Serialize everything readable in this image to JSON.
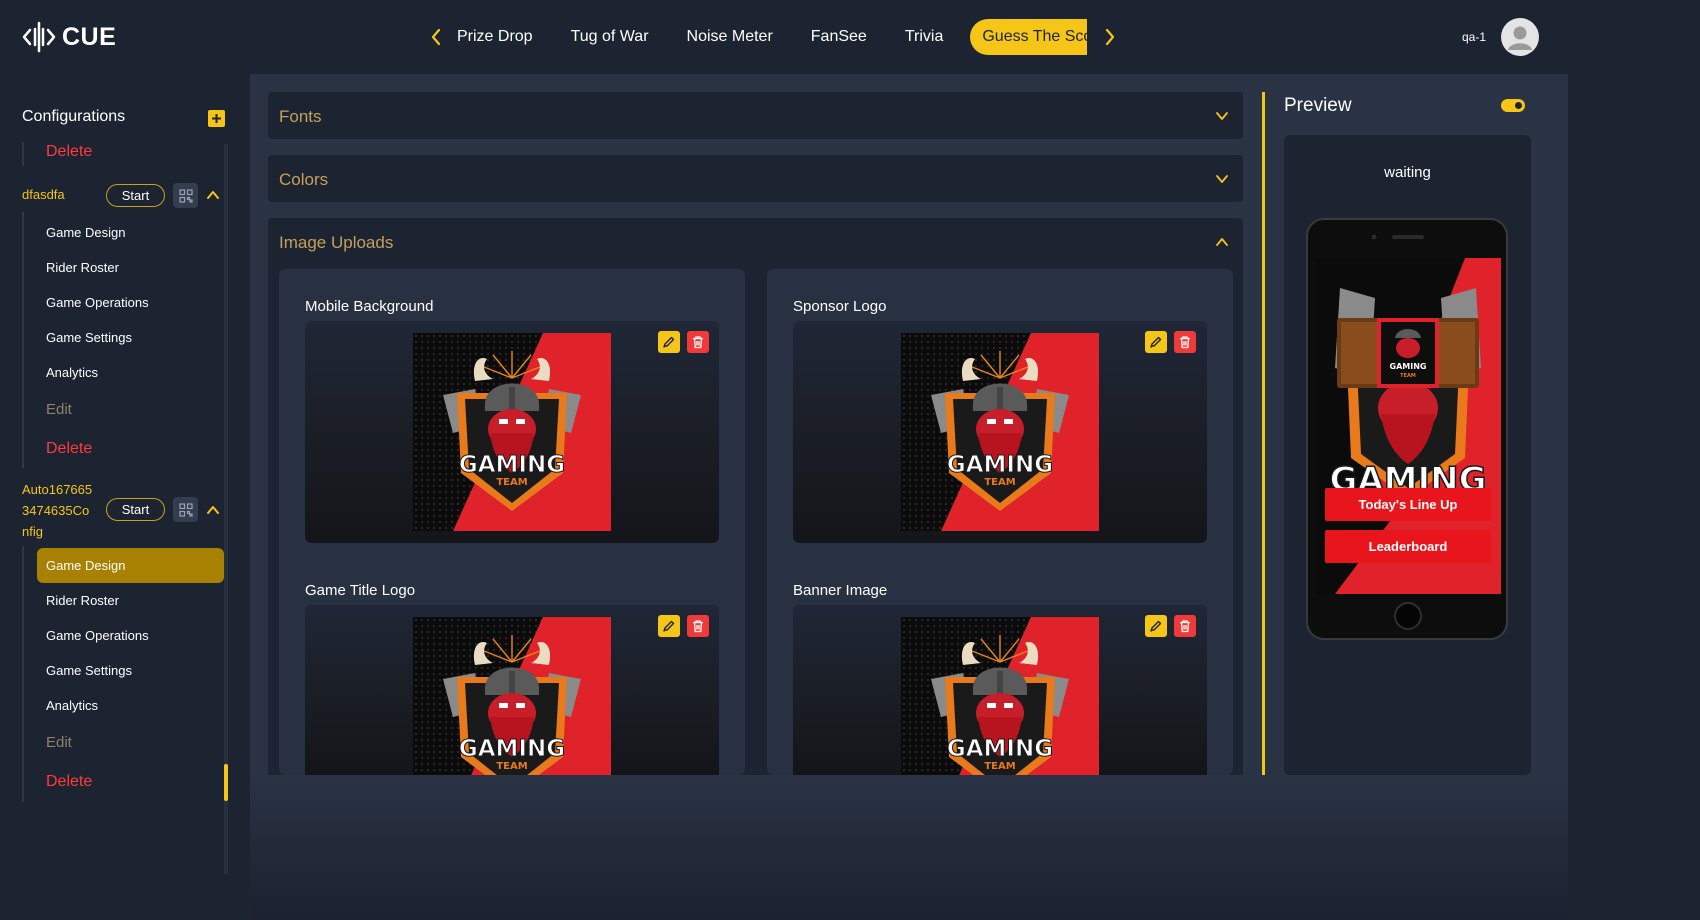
{
  "app": {
    "logo_text": "CUE",
    "logo_icon": "soundwave-icon"
  },
  "nav": {
    "tabs": [
      {
        "label": "Prize Drop",
        "active": false
      },
      {
        "label": "Tug of War",
        "active": false
      },
      {
        "label": "Noise Meter",
        "active": false
      },
      {
        "label": "FanSee",
        "active": false
      },
      {
        "label": "Trivia",
        "active": false
      },
      {
        "label": "Guess The Score",
        "active": true
      }
    ],
    "prev_icon": "chevron-left-icon",
    "next_icon": "chevron-right-icon"
  },
  "user": {
    "name": "qa-1",
    "avatar_icon": "user-avatar-icon"
  },
  "sidebar": {
    "title": "Configurations",
    "add_icon": "plus-icon",
    "top_delete": "Delete",
    "groups": [
      {
        "name": "dfasdfa",
        "start_label": "Start",
        "qr_icon": "qr-code-icon",
        "items": [
          "Game Design",
          "Rider Roster",
          "Game Operations",
          "Game Settings",
          "Analytics"
        ],
        "edit_label": "Edit",
        "delete_label": "Delete"
      },
      {
        "name_lines": [
          "Auto167665",
          "3474635Co",
          "nfig"
        ],
        "start_label": "Start",
        "qr_icon": "qr-code-icon",
        "items": [
          "Game Design",
          "Rider Roster",
          "Game Operations",
          "Game Settings",
          "Analytics"
        ],
        "active_item": "Game Design",
        "edit_label": "Edit",
        "delete_label": "Delete"
      }
    ]
  },
  "sections": {
    "fonts": {
      "title": "Fonts",
      "expanded": false
    },
    "colors": {
      "title": "Colors",
      "expanded": false
    },
    "image_uploads": {
      "title": "Image Uploads",
      "expanded": true,
      "cards": [
        {
          "label": "Mobile Background",
          "logo_main": "GAMING",
          "logo_sub": "TEAM"
        },
        {
          "label": "Sponsor Logo",
          "logo_main": "GAMING",
          "logo_sub": "TEAM"
        },
        {
          "label": "Game Title Logo",
          "logo_main": "GAMING",
          "logo_sub": "TEAM"
        },
        {
          "label": "Banner Image",
          "logo_main": "GAMING",
          "logo_sub": "TEAM"
        }
      ]
    }
  },
  "preview": {
    "title": "Preview",
    "toggle_on": true,
    "status": "waiting",
    "phone": {
      "sponsor_text": "GAMING",
      "sponsor_sub": "TEAM",
      "big_title": "GAMING",
      "buttons": [
        "Today's Line Up",
        "Leaderboard"
      ]
    }
  },
  "colors": {
    "accent": "#f5c518",
    "danger": "#f03a3a",
    "bg_dark": "#1c2331",
    "bg_main": "#2a3344"
  }
}
